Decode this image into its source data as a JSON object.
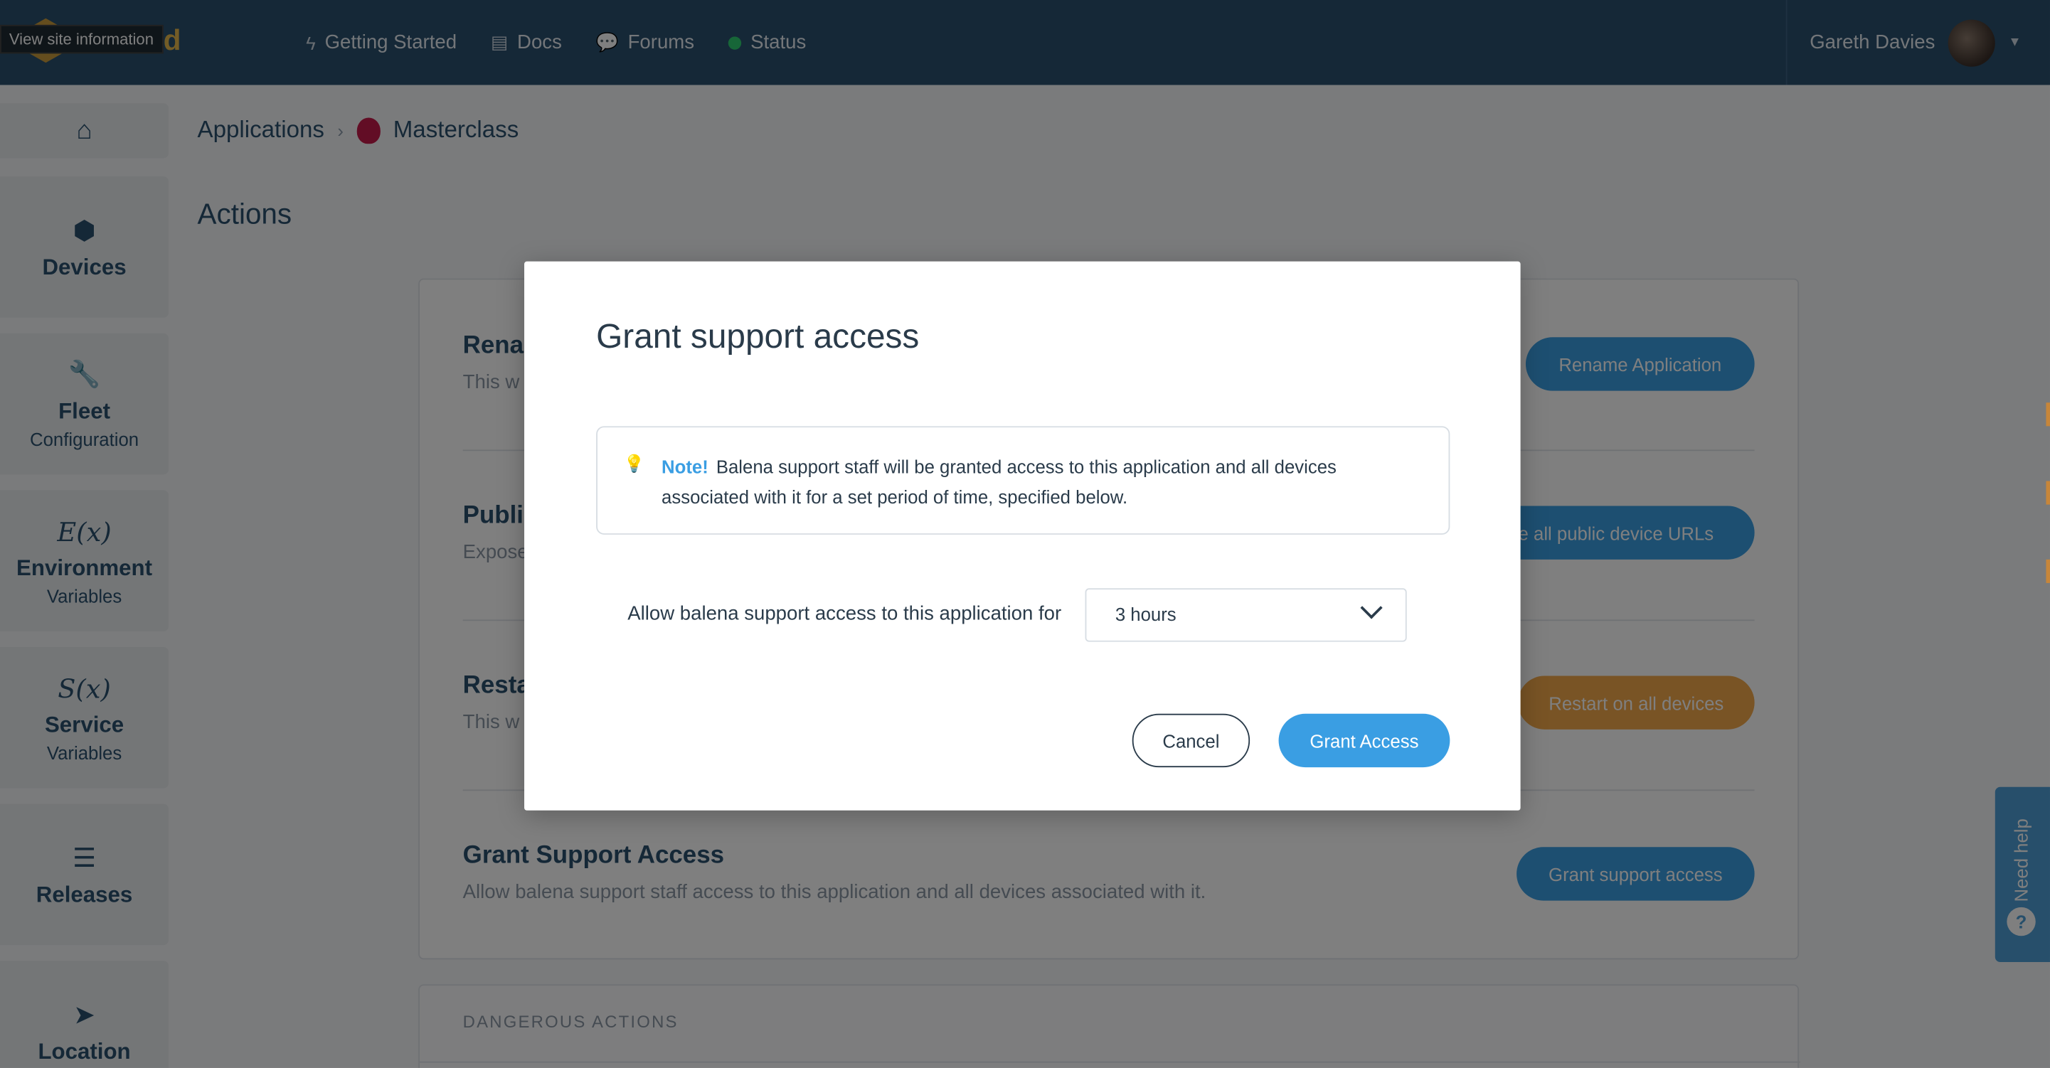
{
  "browser": {
    "site_info_tooltip": "View site information"
  },
  "header": {
    "logo_text": "a Cloud",
    "nav": [
      {
        "label": "Getting Started",
        "icon": "bolt-icon"
      },
      {
        "label": "Docs",
        "icon": "document-icon"
      },
      {
        "label": "Forums",
        "icon": "chat-icon"
      },
      {
        "label": "Status",
        "icon": "status-dot-icon"
      }
    ],
    "user_name": "Gareth Davies",
    "status_color": "#2ecc71"
  },
  "sidebar": {
    "items": [
      {
        "icon": "home-icon",
        "title": "",
        "sub": ""
      },
      {
        "icon": "cube-icon",
        "title": "Devices",
        "sub": ""
      },
      {
        "icon": "wrench-icon",
        "title": "Fleet",
        "sub": "Configuration"
      },
      {
        "icon": "function-icon",
        "icon_text": "E(x)",
        "title": "Environment",
        "sub": "Variables"
      },
      {
        "icon": "function-icon",
        "icon_text": "S(x)",
        "title": "Service",
        "sub": "Variables"
      },
      {
        "icon": "layers-icon",
        "title": "Releases",
        "sub": ""
      },
      {
        "icon": "location-arrow-icon",
        "title": "Location",
        "sub": ""
      }
    ]
  },
  "breadcrumb": {
    "root": "Applications",
    "current": "Masterclass"
  },
  "page": {
    "title": "Actions"
  },
  "actions": {
    "rename": {
      "title": "Renar",
      "desc": "This w",
      "button": "Rename Application"
    },
    "public": {
      "title": "Publi",
      "desc": "Expose",
      "button": "le all public device URLs"
    },
    "restart": {
      "title": "Resta",
      "desc": "This w",
      "button": "Restart on all devices"
    },
    "support": {
      "title": "Grant Support Access",
      "desc": "Allow balena support staff access to this application and all devices associated with it.",
      "button": "Grant support access"
    },
    "danger_label": "DANGEROUS ACTIONS"
  },
  "help": {
    "label": "Need help",
    "q": "?"
  },
  "modal": {
    "title": "Grant support access",
    "note_label": "Note!",
    "note_text": "Balena support staff will be granted access to this application and all devices associated with it for a set period of time, specified below.",
    "allow_label": "Allow balena support access to this application for",
    "duration_value": "3 hours",
    "cancel_label": "Cancel",
    "grant_label": "Grant Access"
  },
  "colors": {
    "navbar": "#2a506f",
    "accent": "#3a9ee3",
    "warning": "#f2a84a",
    "brand_gold": "#e6b84d"
  }
}
